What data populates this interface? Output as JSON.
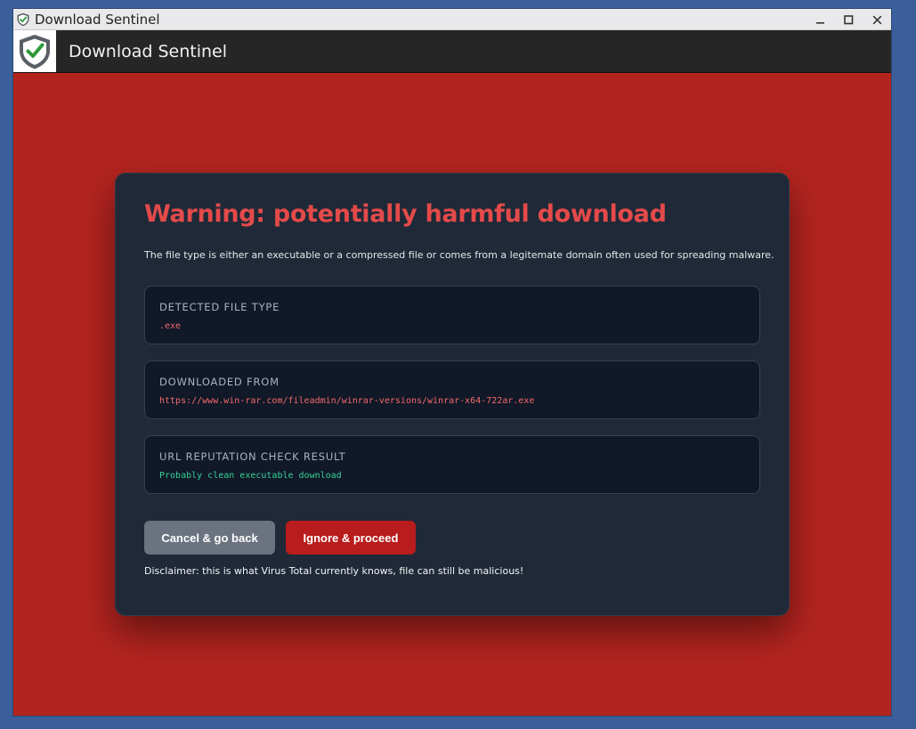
{
  "window": {
    "title": "Download Sentinel",
    "icon": "shield-check-icon"
  },
  "header": {
    "app_title": "Download Sentinel",
    "logo": "shield-check-icon"
  },
  "colors": {
    "background": "#b3241f",
    "card": "#1f2937",
    "warning_title": "#e34a4a",
    "danger_value": "#f26b6b",
    "ok_value": "#34d399",
    "cancel_button": "#6b7280",
    "proceed_button": "#b91c1c"
  },
  "warning": {
    "title": "Warning: potentially harmful download",
    "description": "The file type is either an executable or a compressed file or comes from a legitemate domain often used for spreading malware."
  },
  "details": [
    {
      "label": "DETECTED FILE TYPE",
      "value": ".exe",
      "status": "danger"
    },
    {
      "label": "DOWNLOADED FROM",
      "value": "https://www.win-rar.com/fileadmin/winrar-versions/winrar-x64-722ar.exe",
      "status": "danger"
    },
    {
      "label": "URL REPUTATION CHECK RESULT",
      "value": "Probably clean executable download",
      "status": "ok"
    }
  ],
  "actions": {
    "cancel_label": "Cancel & go back",
    "proceed_label": "Ignore & proceed"
  },
  "disclaimer": "Disclaimer: this is what Virus Total currently knows, file can still be malicious!"
}
